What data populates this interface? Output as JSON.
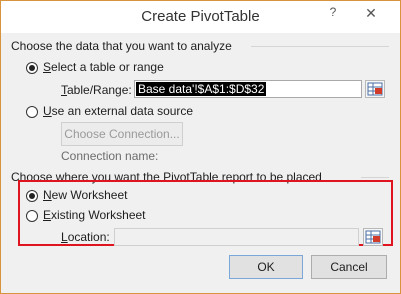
{
  "dialog": {
    "title": "Create PivotTable",
    "help_glyph": "?",
    "close_glyph": "✕"
  },
  "analyze": {
    "heading": "Choose the data that you want to analyze",
    "select_table_label": "Select a table or range",
    "table_range_label": "Table/Range:",
    "table_range_value": "Base data'!$A$1:$D$32",
    "external_label": "Use an external data source",
    "choose_connection_label": "Choose Connection...",
    "connection_name_label": "Connection name:"
  },
  "placement": {
    "heading": "Choose where you want the PivotTable report to be placed",
    "new_worksheet_label": "New Worksheet",
    "existing_worksheet_label": "Existing Worksheet",
    "location_label": "Location:",
    "location_value": ""
  },
  "footer": {
    "ok_label": "OK",
    "cancel_label": "Cancel"
  },
  "selection": {
    "data_source": "select_table_or_range",
    "placement": "new_worksheet"
  },
  "colors": {
    "highlight_border": "#e0141e",
    "window_border": "#d9933c"
  },
  "icons": {
    "collapse_dialog": "collapse-dialog-icon"
  }
}
